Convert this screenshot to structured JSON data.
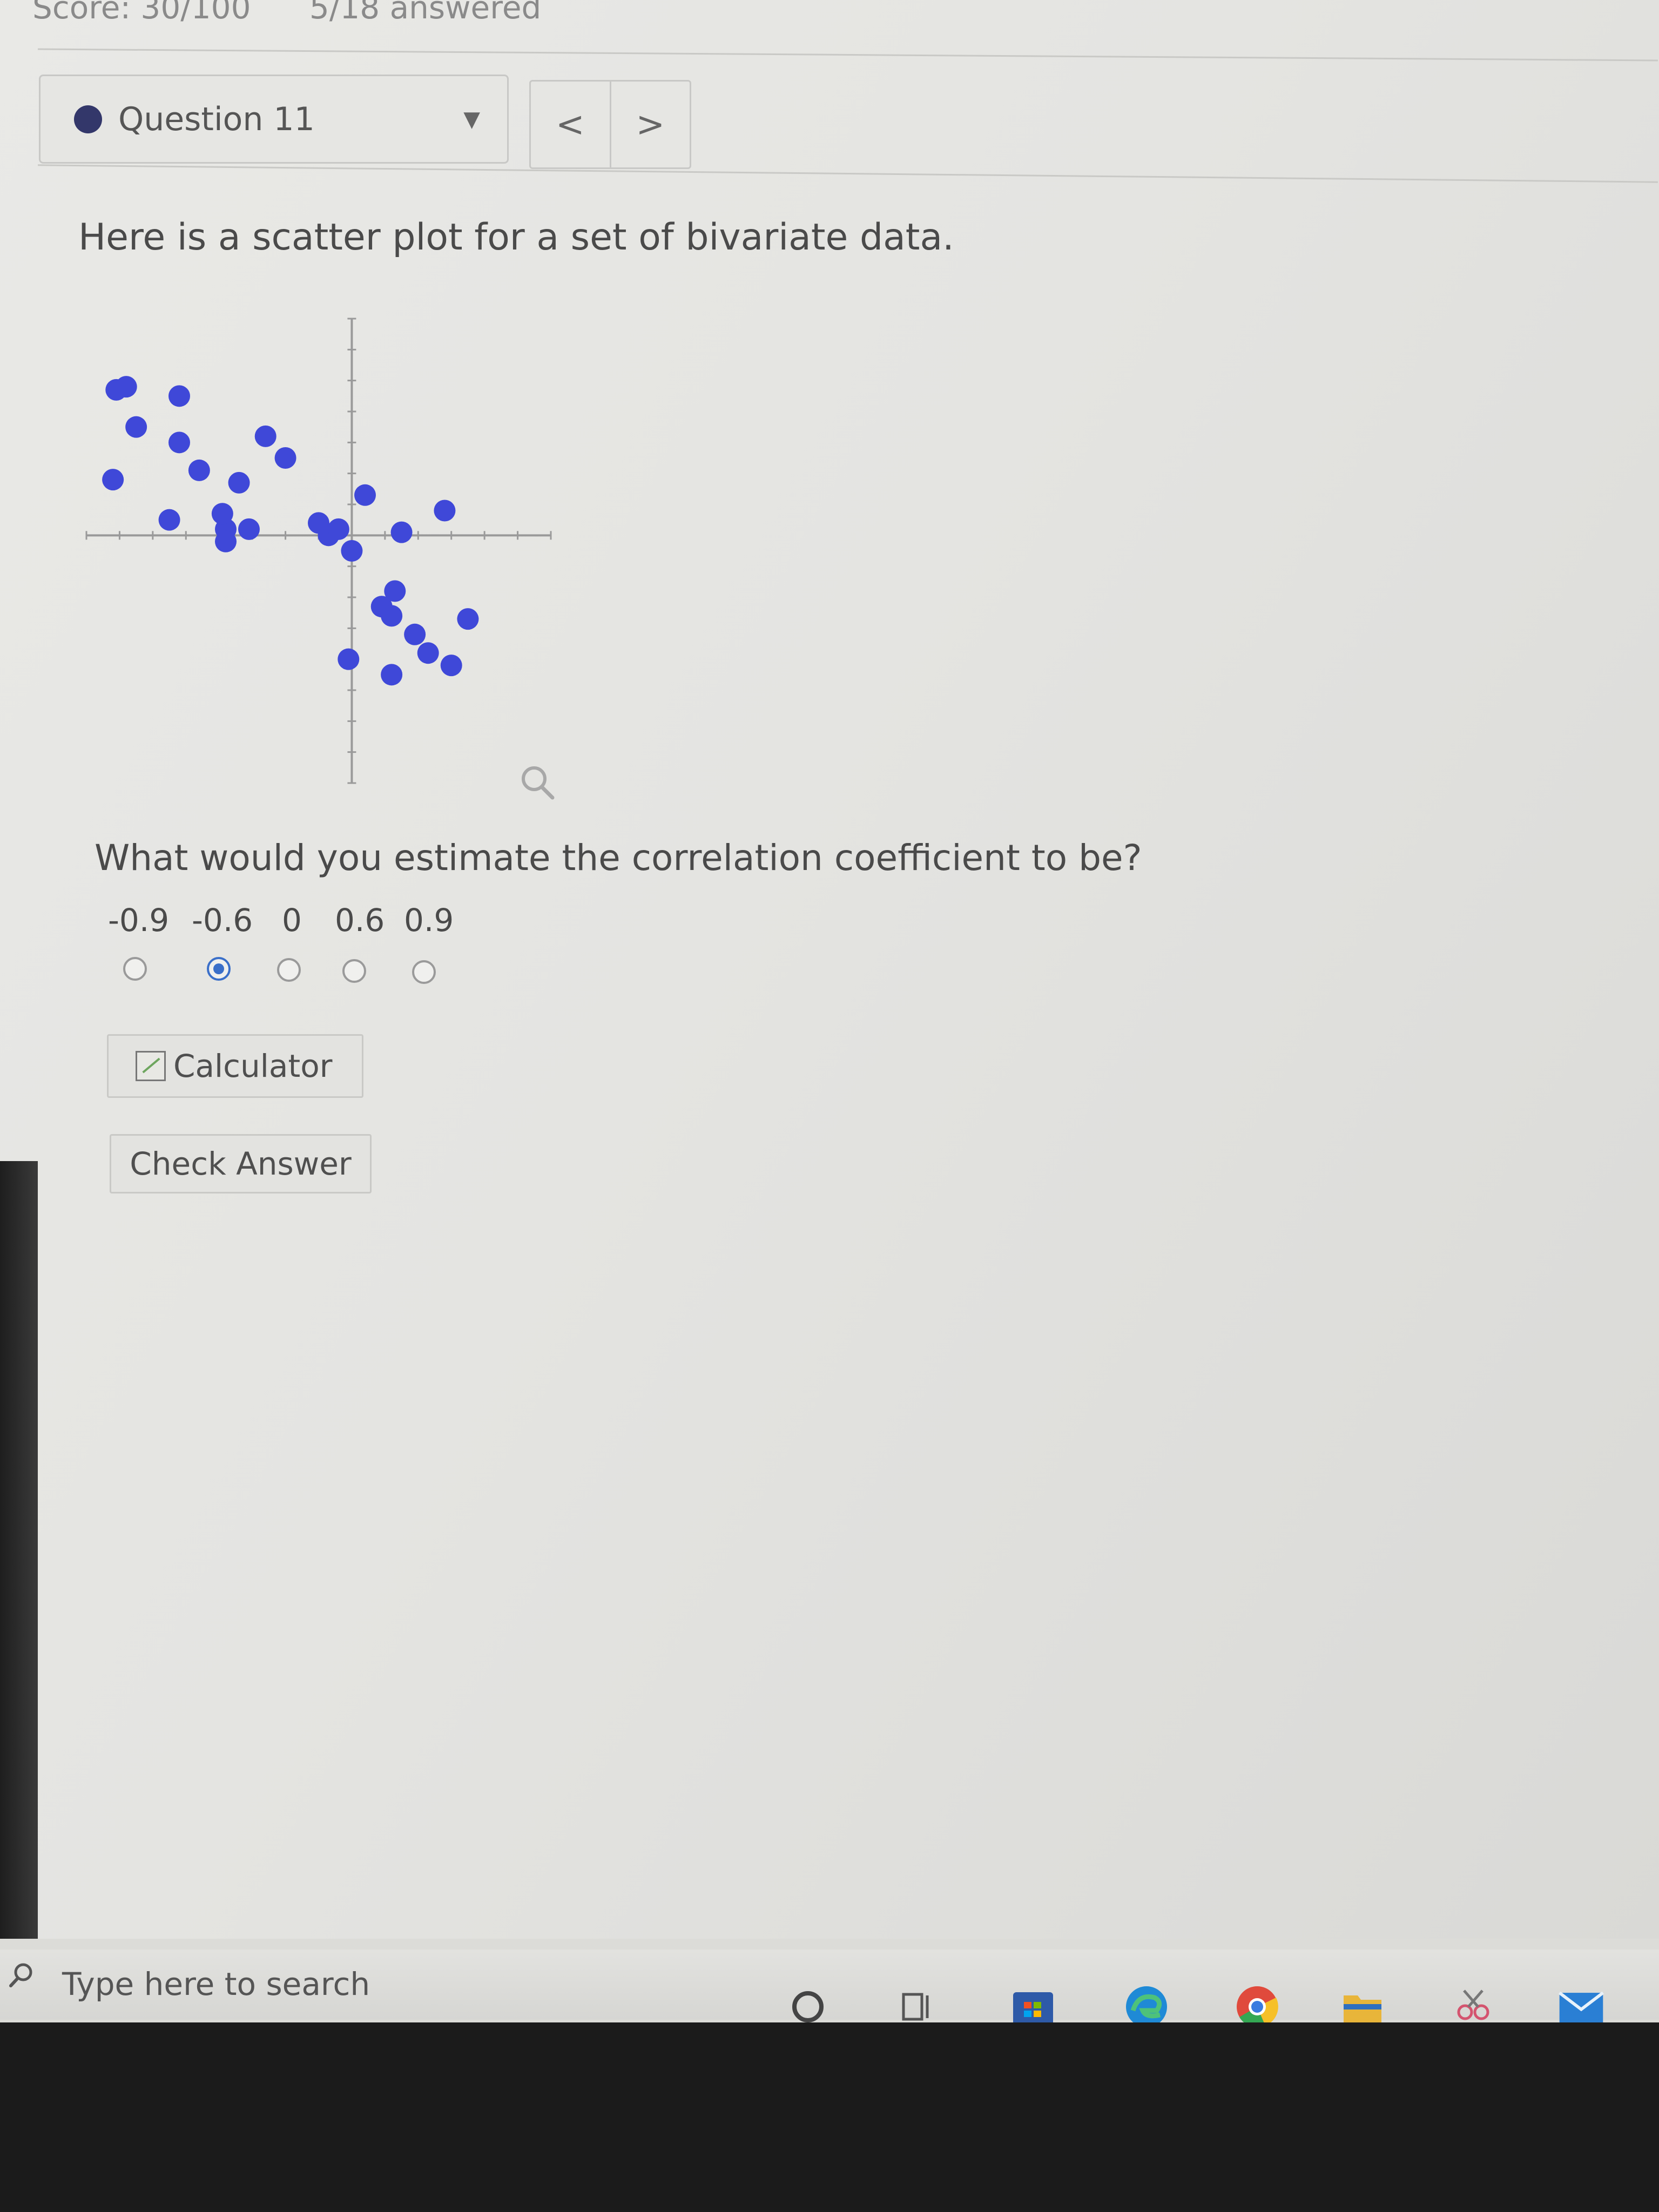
{
  "header": {
    "score": "Score: 30/100",
    "answered": "5/18 answered"
  },
  "question_nav": {
    "label": "Question 11",
    "prev": "<",
    "next": ">"
  },
  "prompt": "Here is a scatter plot for a set of bivariate data.",
  "question": "What would you estimate the correlation coefficient to be?",
  "options": [
    "-0.9",
    "-0.6",
    "0",
    "0.6",
    "0.9"
  ],
  "selected_option": "-0.6",
  "buttons": {
    "calculator": "Calculator",
    "check_answer": "Check Answer"
  },
  "taskbar": {
    "search_placeholder": "Type here to search"
  },
  "colors": {
    "point": "#3f48d8",
    "selected_radio": "#3a6fc9",
    "status_dot": "#33376a"
  },
  "chart_data": {
    "type": "scatter",
    "xlim": [
      -8,
      6
    ],
    "ylim": [
      -8,
      7
    ],
    "points": [
      [
        -7.1,
        4.7
      ],
      [
        -6.8,
        4.8
      ],
      [
        -6.5,
        3.5
      ],
      [
        -7.2,
        1.8
      ],
      [
        -5.2,
        4.5
      ],
      [
        -5.2,
        3.0
      ],
      [
        -4.6,
        2.1
      ],
      [
        -5.5,
        0.5
      ],
      [
        -3.8,
        0.2
      ],
      [
        -3.9,
        0.7
      ],
      [
        -3.8,
        -0.2
      ],
      [
        -3.4,
        1.7
      ],
      [
        -3.1,
        0.2
      ],
      [
        -2.6,
        3.2
      ],
      [
        -2.0,
        2.5
      ],
      [
        -1.0,
        0.4
      ],
      [
        -0.7,
        0.0
      ],
      [
        -0.4,
        0.2
      ],
      [
        0.0,
        -0.5
      ],
      [
        0.4,
        1.3
      ],
      [
        1.5,
        0.1
      ],
      [
        2.8,
        0.8
      ],
      [
        1.3,
        -1.8
      ],
      [
        0.9,
        -2.3
      ],
      [
        1.2,
        -2.6
      ],
      [
        1.9,
        -3.2
      ],
      [
        2.3,
        -3.8
      ],
      [
        1.2,
        -4.5
      ],
      [
        3.0,
        -4.2
      ],
      [
        3.5,
        -2.7
      ],
      [
        -0.1,
        -4.0
      ]
    ]
  }
}
